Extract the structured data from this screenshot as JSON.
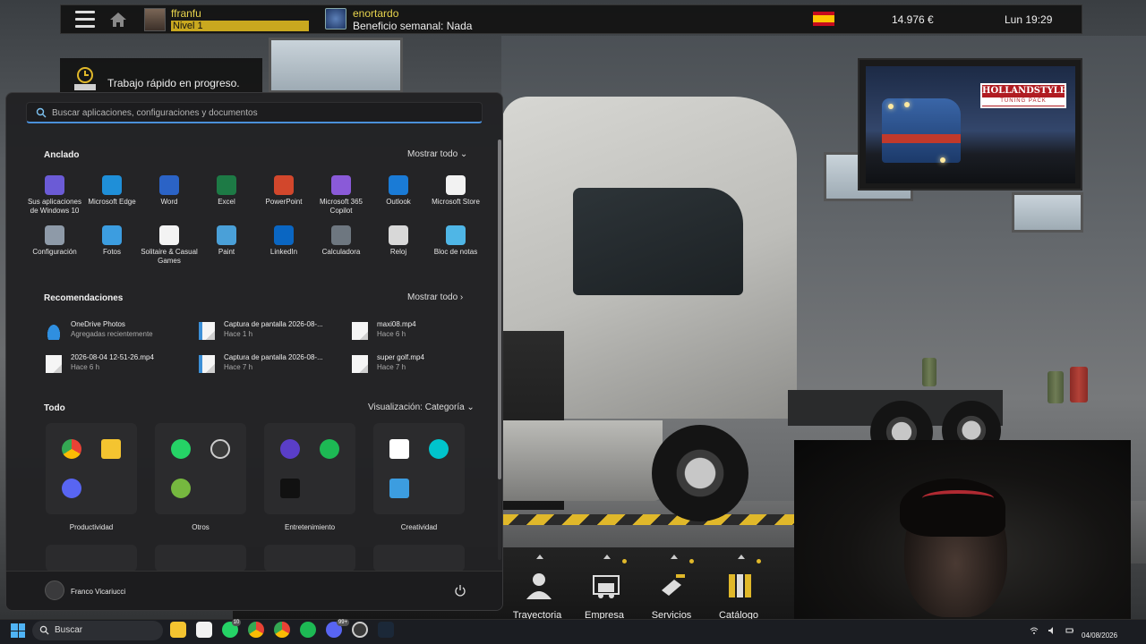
{
  "game": {
    "hud": {
      "player_name": "ffranfu",
      "level_label": "Nivel 1",
      "level_progress": 1.0,
      "company_name": "enortardo",
      "company_benefit": "Beneficio semanal: Nada",
      "money": "14.976 €",
      "time": "Lun 19:29"
    },
    "quick_job": {
      "text": "Trabajo rápido en progreso."
    },
    "promo": {
      "logo_title": "HOLLANDSTYLE",
      "logo_subtitle": "TUNING PACK"
    },
    "bottom_nav": [
      {
        "label": "Trayectoria",
        "icon": "driver-icon"
      },
      {
        "label": "Empresa",
        "icon": "garage-truck-icon"
      },
      {
        "label": "Servicios",
        "icon": "service-icon"
      },
      {
        "label": "Catálogo",
        "icon": "catalog-icon"
      }
    ]
  },
  "start_menu": {
    "search_placeholder": "Buscar aplicaciones, configuraciones y documentos",
    "pinned_title": "Anclado",
    "pinned_show_all": "Mostrar todo",
    "pinned": [
      {
        "label": "Sus aplicaciones de Windows 10",
        "icon": "apps-grid-icon",
        "color": "#6b5bd6"
      },
      {
        "label": "Microsoft Edge",
        "icon": "edge-icon",
        "color": "#1f8fd8"
      },
      {
        "label": "Word",
        "icon": "word-icon",
        "color": "#2b63c6"
      },
      {
        "label": "Excel",
        "icon": "excel-icon",
        "color": "#1d7a45"
      },
      {
        "label": "PowerPoint",
        "icon": "powerpoint-icon",
        "color": "#d2472c"
      },
      {
        "label": "Microsoft 365 Copilot",
        "icon": "m365-icon",
        "color": "#8a5ad8"
      },
      {
        "label": "Outlook",
        "icon": "outlook-icon",
        "color": "#1a7bd6"
      },
      {
        "label": "Microsoft Store",
        "icon": "store-icon",
        "color": "#f2f2f2"
      },
      {
        "label": "Configuración",
        "icon": "gear-icon",
        "color": "#8e9aa8"
      },
      {
        "label": "Fotos",
        "icon": "photos-icon",
        "color": "#3c9de0"
      },
      {
        "label": "Solitaire & Casual Games",
        "icon": "cards-icon",
        "color": "#f3f3f3"
      },
      {
        "label": "Paint",
        "icon": "paint-icon",
        "color": "#4aa0d8"
      },
      {
        "label": "LinkedIn",
        "icon": "linkedin-icon",
        "color": "#0a66c2"
      },
      {
        "label": "Calculadora",
        "icon": "calculator-icon",
        "color": "#6e7780"
      },
      {
        "label": "Reloj",
        "icon": "clock-icon",
        "color": "#d8d8d8"
      },
      {
        "label": "Bloc de notas",
        "icon": "notepad-icon",
        "color": "#4fb6e6"
      }
    ],
    "recommended_title": "Recomendaciones",
    "recommended_show_all": "Mostrar todo",
    "recommended": [
      {
        "title": "OneDrive Photos",
        "subtitle": "Agregadas recientemente",
        "icon": "onedrive-icon"
      },
      {
        "title": "Captura de pantalla 2026-08-...",
        "subtitle": "Hace 1 h",
        "icon": "image-file-icon"
      },
      {
        "title": "maxi08.mp4",
        "subtitle": "Hace 6 h",
        "icon": "video-file-icon"
      },
      {
        "title": "2026-08-04 12-51-26.mp4",
        "subtitle": "Hace 6 h",
        "icon": "video-file-icon"
      },
      {
        "title": "Captura de pantalla 2026-08-...",
        "subtitle": "Hace 7 h",
        "icon": "image-file-icon"
      },
      {
        "title": "super golf.mp4",
        "subtitle": "Hace 7 h",
        "icon": "video-file-icon"
      }
    ],
    "all_title": "Todo",
    "view_label": "Visualización: Categoría",
    "categories": [
      {
        "label": "Productividad",
        "apps": [
          {
            "icon": "chrome-icon",
            "color": "#e94235"
          },
          {
            "icon": "file-explorer-icon",
            "color": "#f4c430"
          },
          {
            "icon": "discord-icon",
            "color": "#5865f2"
          }
        ]
      },
      {
        "label": "Otros",
        "apps": [
          {
            "icon": "whatsapp-icon",
            "color": "#25d366"
          },
          {
            "icon": "obs-icon",
            "color": "#3a3a3a"
          },
          {
            "icon": "utorrent-icon",
            "color": "#76b83f"
          }
        ]
      },
      {
        "label": "Entretenimiento",
        "apps": [
          {
            "icon": "media-player-icon",
            "color": "#5a3ec8"
          },
          {
            "icon": "spotify-icon",
            "color": "#1db954"
          },
          {
            "icon": "epic-games-icon",
            "color": "#111111"
          }
        ]
      },
      {
        "label": "Creatividad",
        "apps": [
          {
            "icon": "capcut-icon",
            "color": "#ffffff"
          },
          {
            "icon": "canva-icon",
            "color": "#00c4cc"
          },
          {
            "icon": "photos-icon",
            "color": "#3c9de0"
          }
        ]
      }
    ],
    "user_name": "Franco Vicariucci"
  },
  "taskbar": {
    "search_label": "Buscar",
    "badges": [
      "10",
      "99+"
    ],
    "date": "04/08/2026",
    "apps": [
      {
        "icon": "file-explorer-icon",
        "color": "#f4c430"
      },
      {
        "icon": "store-icon",
        "color": "#f2f2f2"
      },
      {
        "icon": "whatsapp-icon",
        "color": "#25d366"
      },
      {
        "icon": "chrome-icon",
        "color": "#e94235"
      },
      {
        "icon": "chrome-icon",
        "color": "#e94235"
      },
      {
        "icon": "spotify-icon",
        "color": "#1db954"
      },
      {
        "icon": "discord-icon",
        "color": "#5865f2"
      },
      {
        "icon": "obs-icon",
        "color": "#3a3a3a"
      },
      {
        "icon": "steam-icon",
        "color": "#1b2838"
      }
    ]
  }
}
